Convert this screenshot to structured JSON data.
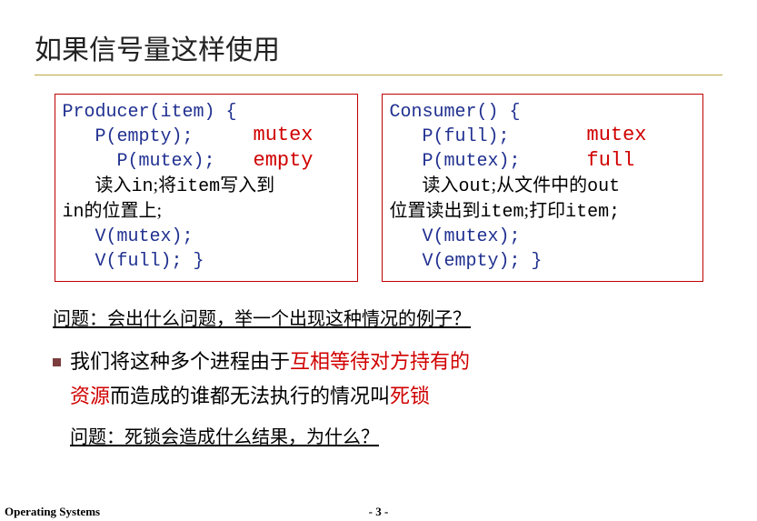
{
  "title": "如果信号量这样使用",
  "producer": {
    "head": "Producer(item) {",
    "l1": "P(empty);",
    "l2": "P(mutex);",
    "txt1": "读入",
    "txt1b": "in",
    "txt1c": ";将",
    "txt1d": "item",
    "txt1e": "写入到",
    "txt2a": "in",
    "txt2b": "的位置上;",
    "l3": "V(mutex);",
    "l4": "V(full);",
    "tail": " }",
    "anno1": "mutex",
    "anno2": "empty"
  },
  "consumer": {
    "head": "Consumer() {",
    "l1": "P(full);",
    "l2": "P(mutex);",
    "txt1": "读入",
    "txt1b": "out",
    "txt1c": ";从文件中的",
    "txt1d": "out",
    "txt2a": "位置读出到",
    "txt2b": "item",
    "txt2c": ";打印",
    "txt2d": "item",
    "txt2e": ";",
    "l3": "V(mutex);",
    "l4": "V(empty);",
    "tail": " }",
    "anno1": "mutex",
    "anno2": "full"
  },
  "q1": "问题：会出什么问题，举一个出现这种情况的例子？",
  "para": {
    "p1a": "我们将这种多个进程由于",
    "p1b": "互相等待对方持有的",
    "p2a": "资源",
    "p2b": "而造成的谁都无法执行的情况叫",
    "p2c": "死锁"
  },
  "q2": "问题：死锁会造成什么结果，为什么？",
  "footer_left": "Operating Systems",
  "footer_center": "- 3 -"
}
